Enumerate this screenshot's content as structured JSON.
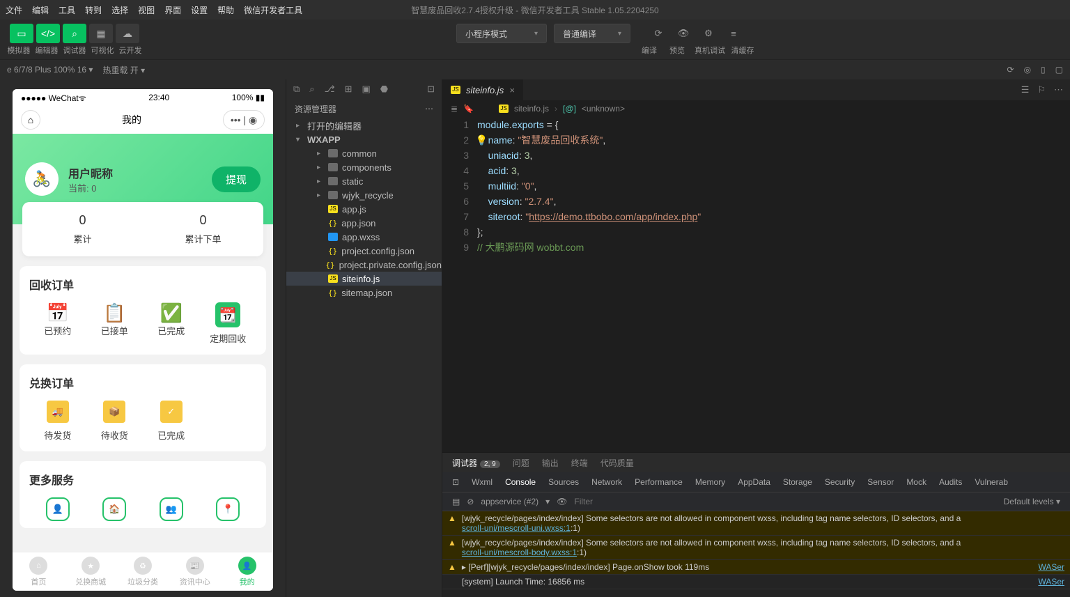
{
  "menubar": {
    "items": [
      "文件",
      "编辑",
      "工具",
      "转到",
      "选择",
      "视图",
      "界面",
      "设置",
      "帮助",
      "微信开发者工具"
    ],
    "title": "智慧废品回收2.7.4授权升级 - 微信开发者工具 Stable 1.05.2204250"
  },
  "toolbar": {
    "labels": [
      "模拟器",
      "编辑器",
      "调试器",
      "可视化",
      "云开发"
    ],
    "mode_select": "小程序模式",
    "compile_select": "普通编译",
    "right_labels": [
      "编译",
      "预览",
      "真机调试",
      "清缓存"
    ]
  },
  "secondary": {
    "device": "e 6/7/8 Plus 100% 16",
    "reload": "热重载 开"
  },
  "explorer": {
    "header": "资源管理器",
    "groups": [
      {
        "label": "打开的编辑器",
        "caret": "▸"
      },
      {
        "label": "WXAPP",
        "caret": "▾"
      }
    ],
    "tree": [
      {
        "type": "folder",
        "label": "common",
        "caret": "▸",
        "lvl": 2
      },
      {
        "type": "folder",
        "label": "components",
        "caret": "▸",
        "lvl": 2
      },
      {
        "type": "folder",
        "label": "static",
        "caret": "▸",
        "lvl": 2
      },
      {
        "type": "folder",
        "label": "wjyk_recycle",
        "caret": "▸",
        "lvl": 2
      },
      {
        "type": "js",
        "label": "app.js",
        "lvl": 2
      },
      {
        "type": "json",
        "label": "app.json",
        "lvl": 2
      },
      {
        "type": "wxss",
        "label": "app.wxss",
        "lvl": 2
      },
      {
        "type": "json",
        "label": "project.config.json",
        "lvl": 2
      },
      {
        "type": "json",
        "label": "project.private.config.json",
        "lvl": 2
      },
      {
        "type": "js",
        "label": "siteinfo.js",
        "lvl": 2,
        "selected": true
      },
      {
        "type": "json",
        "label": "sitemap.json",
        "lvl": 2
      }
    ]
  },
  "editor": {
    "tab_name": "siteinfo.js",
    "breadcrumb": [
      "siteinfo.js",
      "<unknown>"
    ],
    "bc_icon": "[@]",
    "code": {
      "l1": {
        "a": "module",
        "b": ".",
        "c": "exports",
        "d": " = {"
      },
      "l2": {
        "a": "name",
        "b": ": ",
        "c": "\"智慧废品回收系统\"",
        "d": ","
      },
      "l3": {
        "a": "uniacid",
        "b": ": ",
        "c": "3",
        "d": ","
      },
      "l4": {
        "a": "acid",
        "b": ": ",
        "c": "3",
        "d": ","
      },
      "l5": {
        "a": "multiid",
        "b": ": ",
        "c": "\"0\"",
        "d": ","
      },
      "l6": {
        "a": "version",
        "b": ": ",
        "c": "\"2.7.4\"",
        "d": ","
      },
      "l7": {
        "a": "siteroot",
        "b": ": ",
        "c": "\"",
        "d": "https://demo.ttbobo.com/app/index.php",
        "e": "\""
      },
      "l8": "};",
      "l9": "// 大鹏源码网 wobbt.com"
    }
  },
  "phone": {
    "status": {
      "carrier": "●●●●● WeChat",
      "wifi": "ᯤ",
      "time": "23:40",
      "battery": "100%"
    },
    "header_title": "我的",
    "user": {
      "nick": "用户昵称",
      "balance_label": "当前:",
      "balance": "0",
      "withdraw": "提现"
    },
    "stats": [
      {
        "num": "0",
        "label": "累计"
      },
      {
        "num": "0",
        "label": "累计下单"
      }
    ],
    "section1": {
      "title": "回收订单",
      "items": [
        "已预约",
        "已接单",
        "已完成",
        "定期回收"
      ]
    },
    "section2": {
      "title": "兑换订单",
      "items": [
        "待发货",
        "待收货",
        "已完成"
      ]
    },
    "section3": {
      "title": "更多服务"
    },
    "tabs": [
      "首页",
      "兑换商城",
      "垃圾分类",
      "资讯中心",
      "我的"
    ]
  },
  "devtools": {
    "top_tabs": [
      "调试器",
      "问题",
      "输出",
      "终端",
      "代码质量"
    ],
    "top_badge": "2, 9",
    "tabs": [
      "Wxml",
      "Console",
      "Sources",
      "Network",
      "Performance",
      "Memory",
      "AppData",
      "Storage",
      "Security",
      "Sensor",
      "Mock",
      "Audits",
      "Vulnerab"
    ],
    "active_tab": "Console",
    "filter": {
      "context": "appservice (#2)",
      "placeholder": "Filter",
      "levels": "Default levels"
    },
    "rows": [
      {
        "type": "warn",
        "text": "[wjyk_recycle/pages/index/index] Some selectors are not allowed in component wxss, including tag name selectors, ID selectors, and a",
        "link": "scroll-uni/mescroll-uni.wxss:1",
        "tail": ":1)"
      },
      {
        "type": "warn",
        "text": "[wjyk_recycle/pages/index/index] Some selectors are not allowed in component wxss, including tag name selectors, ID selectors, and a",
        "link": "scroll-uni/mescroll-body.wxss:1",
        "tail": ":1)"
      },
      {
        "type": "warn",
        "text": "▸ [Perf][wjyk_recycle/pages/index/index] Page.onShow took 119ms",
        "rlink": "WASer"
      },
      {
        "type": "log",
        "text": "[system] Launch Time: 16856 ms",
        "rlink": "WASer"
      }
    ]
  }
}
